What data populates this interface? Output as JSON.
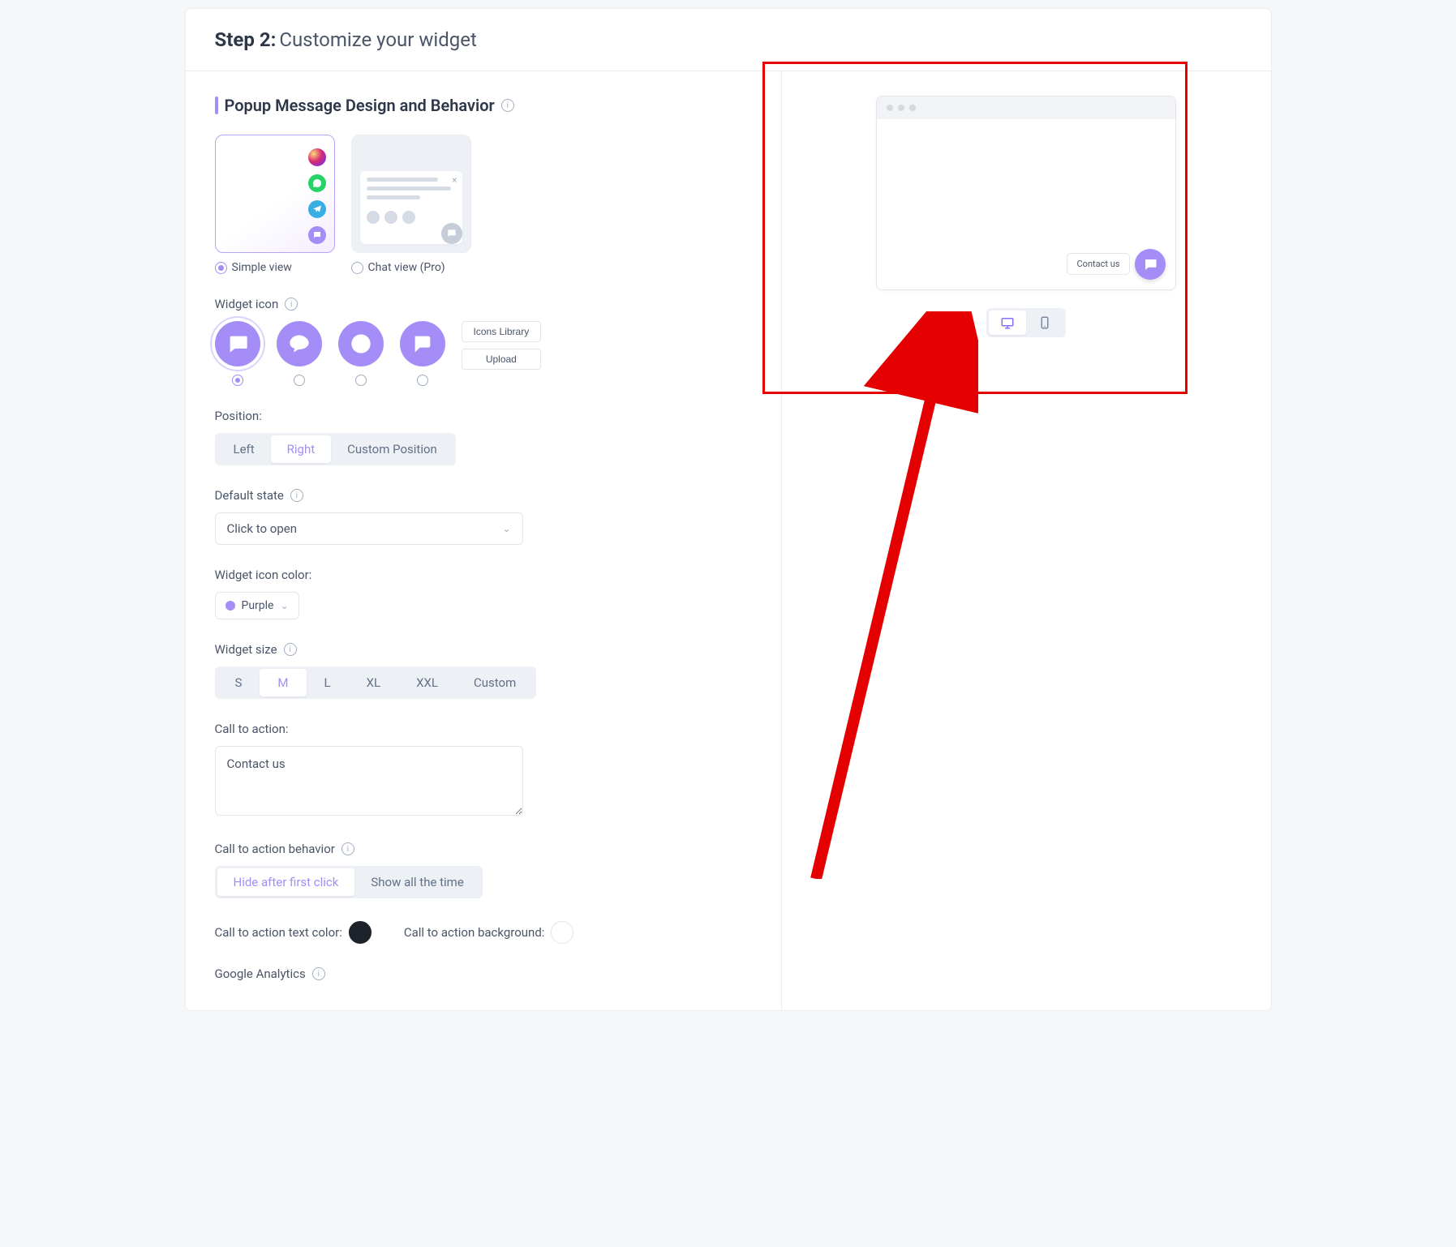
{
  "header": {
    "step": "Step 2:",
    "title": "Customize your widget"
  },
  "section": {
    "title": "Popup Message Design and Behavior"
  },
  "design": {
    "simple": {
      "label": "Simple view"
    },
    "chat": {
      "label": "Chat view (Pro)"
    }
  },
  "widget_icon": {
    "label": "Widget icon",
    "icons_library": "Icons Library",
    "upload": "Upload"
  },
  "position": {
    "label": "Position:",
    "options": [
      "Left",
      "Right",
      "Custom Position"
    ],
    "selected": "Right"
  },
  "default_state": {
    "label": "Default state",
    "value": "Click to open"
  },
  "icon_color": {
    "label": "Widget icon color:",
    "value": "Purple"
  },
  "size": {
    "label": "Widget size",
    "options": [
      "S",
      "M",
      "L",
      "XL",
      "XXL",
      "Custom"
    ],
    "selected": "M"
  },
  "cta": {
    "label": "Call to action:",
    "value": "Contact us"
  },
  "cta_behavior": {
    "label": "Call to action behavior",
    "options": [
      "Hide after first click",
      "Show all the time"
    ],
    "selected": "Hide after first click"
  },
  "cta_text_color": {
    "label": "Call to action text color:",
    "value": "#1e222a"
  },
  "cta_bg": {
    "label": "Call to action background:",
    "value": "#ffffff"
  },
  "ga": {
    "label": "Google Analytics"
  },
  "preview": {
    "cta": "Contact us"
  }
}
